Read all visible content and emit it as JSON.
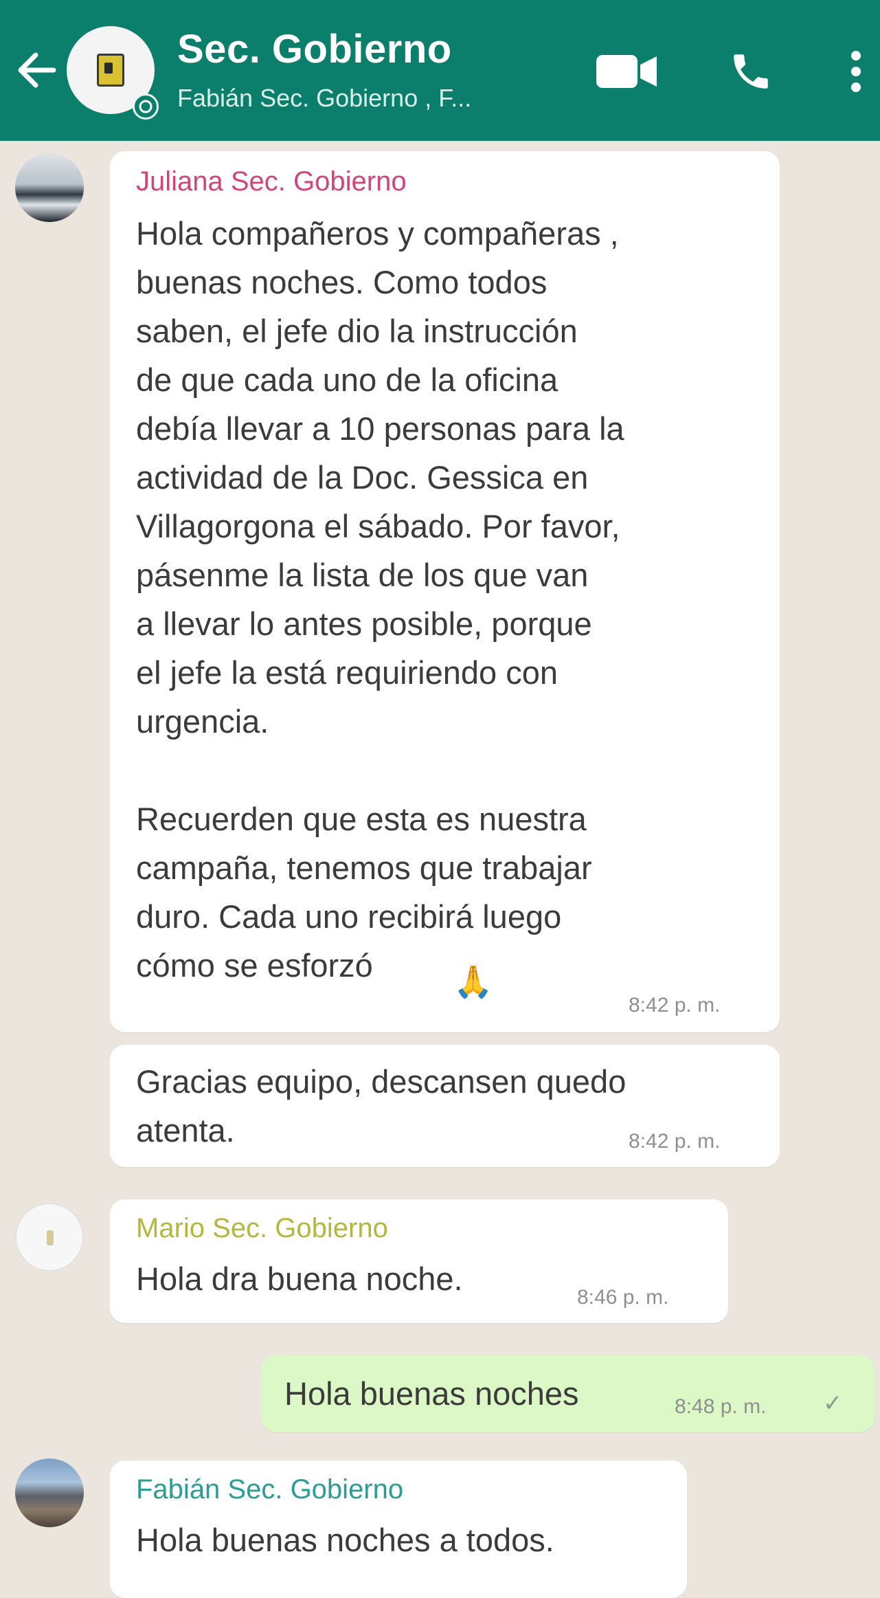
{
  "header": {
    "title": "Sec. Gobierno",
    "members": "Fabián Sec. Gobierno , F...",
    "back_icon": "arrow-back-icon",
    "video_icon": "video-camera-icon",
    "call_icon": "phone-icon",
    "menu_icon": "more-vertical-icon",
    "colors": {
      "bar": "#0b7f6c",
      "chat_bg": "#ece5dd",
      "outgoing_bubble": "#dcf8c6"
    }
  },
  "messages": [
    {
      "sender": "Juliana Sec. Gobierno",
      "sender_color": "#d1457a",
      "text": "Hola compañeros y compañeras ,\nbuenas noches. Como todos\nsaben, el jefe dio la instrucción\nde que cada uno de la oficina\ndebía llevar a 10 personas para la\nactividad de la Doc. Gessica en\nVillagorgona el sábado. Por favor,\npásenme la lista de los que van\na llevar lo antes posible, porque\nel jefe la está requiriendo con\nurgencia.\n\nRecuerden que esta es nuestra\ncampaña, tenemos que trabajar\nduro. Cada uno recibirá luego\ncómo se esforzó",
      "emoji": "🙏",
      "time": "8:42 p. m."
    },
    {
      "text": "Gracias equipo, descansen quedo\natenta.",
      "time": "8:42 p. m."
    },
    {
      "sender": "Mario Sec. Gobierno",
      "sender_color": "#b3b83a",
      "text": "Hola dra buena noche.",
      "time": "8:46 p. m."
    },
    {
      "text": "Hola buenas noches",
      "time": "8:48 p. m.",
      "status": "✓"
    },
    {
      "sender": "Fabián Sec. Gobierno",
      "sender_color": "#2a9d94",
      "text": "Hola buenas noches a todos."
    }
  ]
}
